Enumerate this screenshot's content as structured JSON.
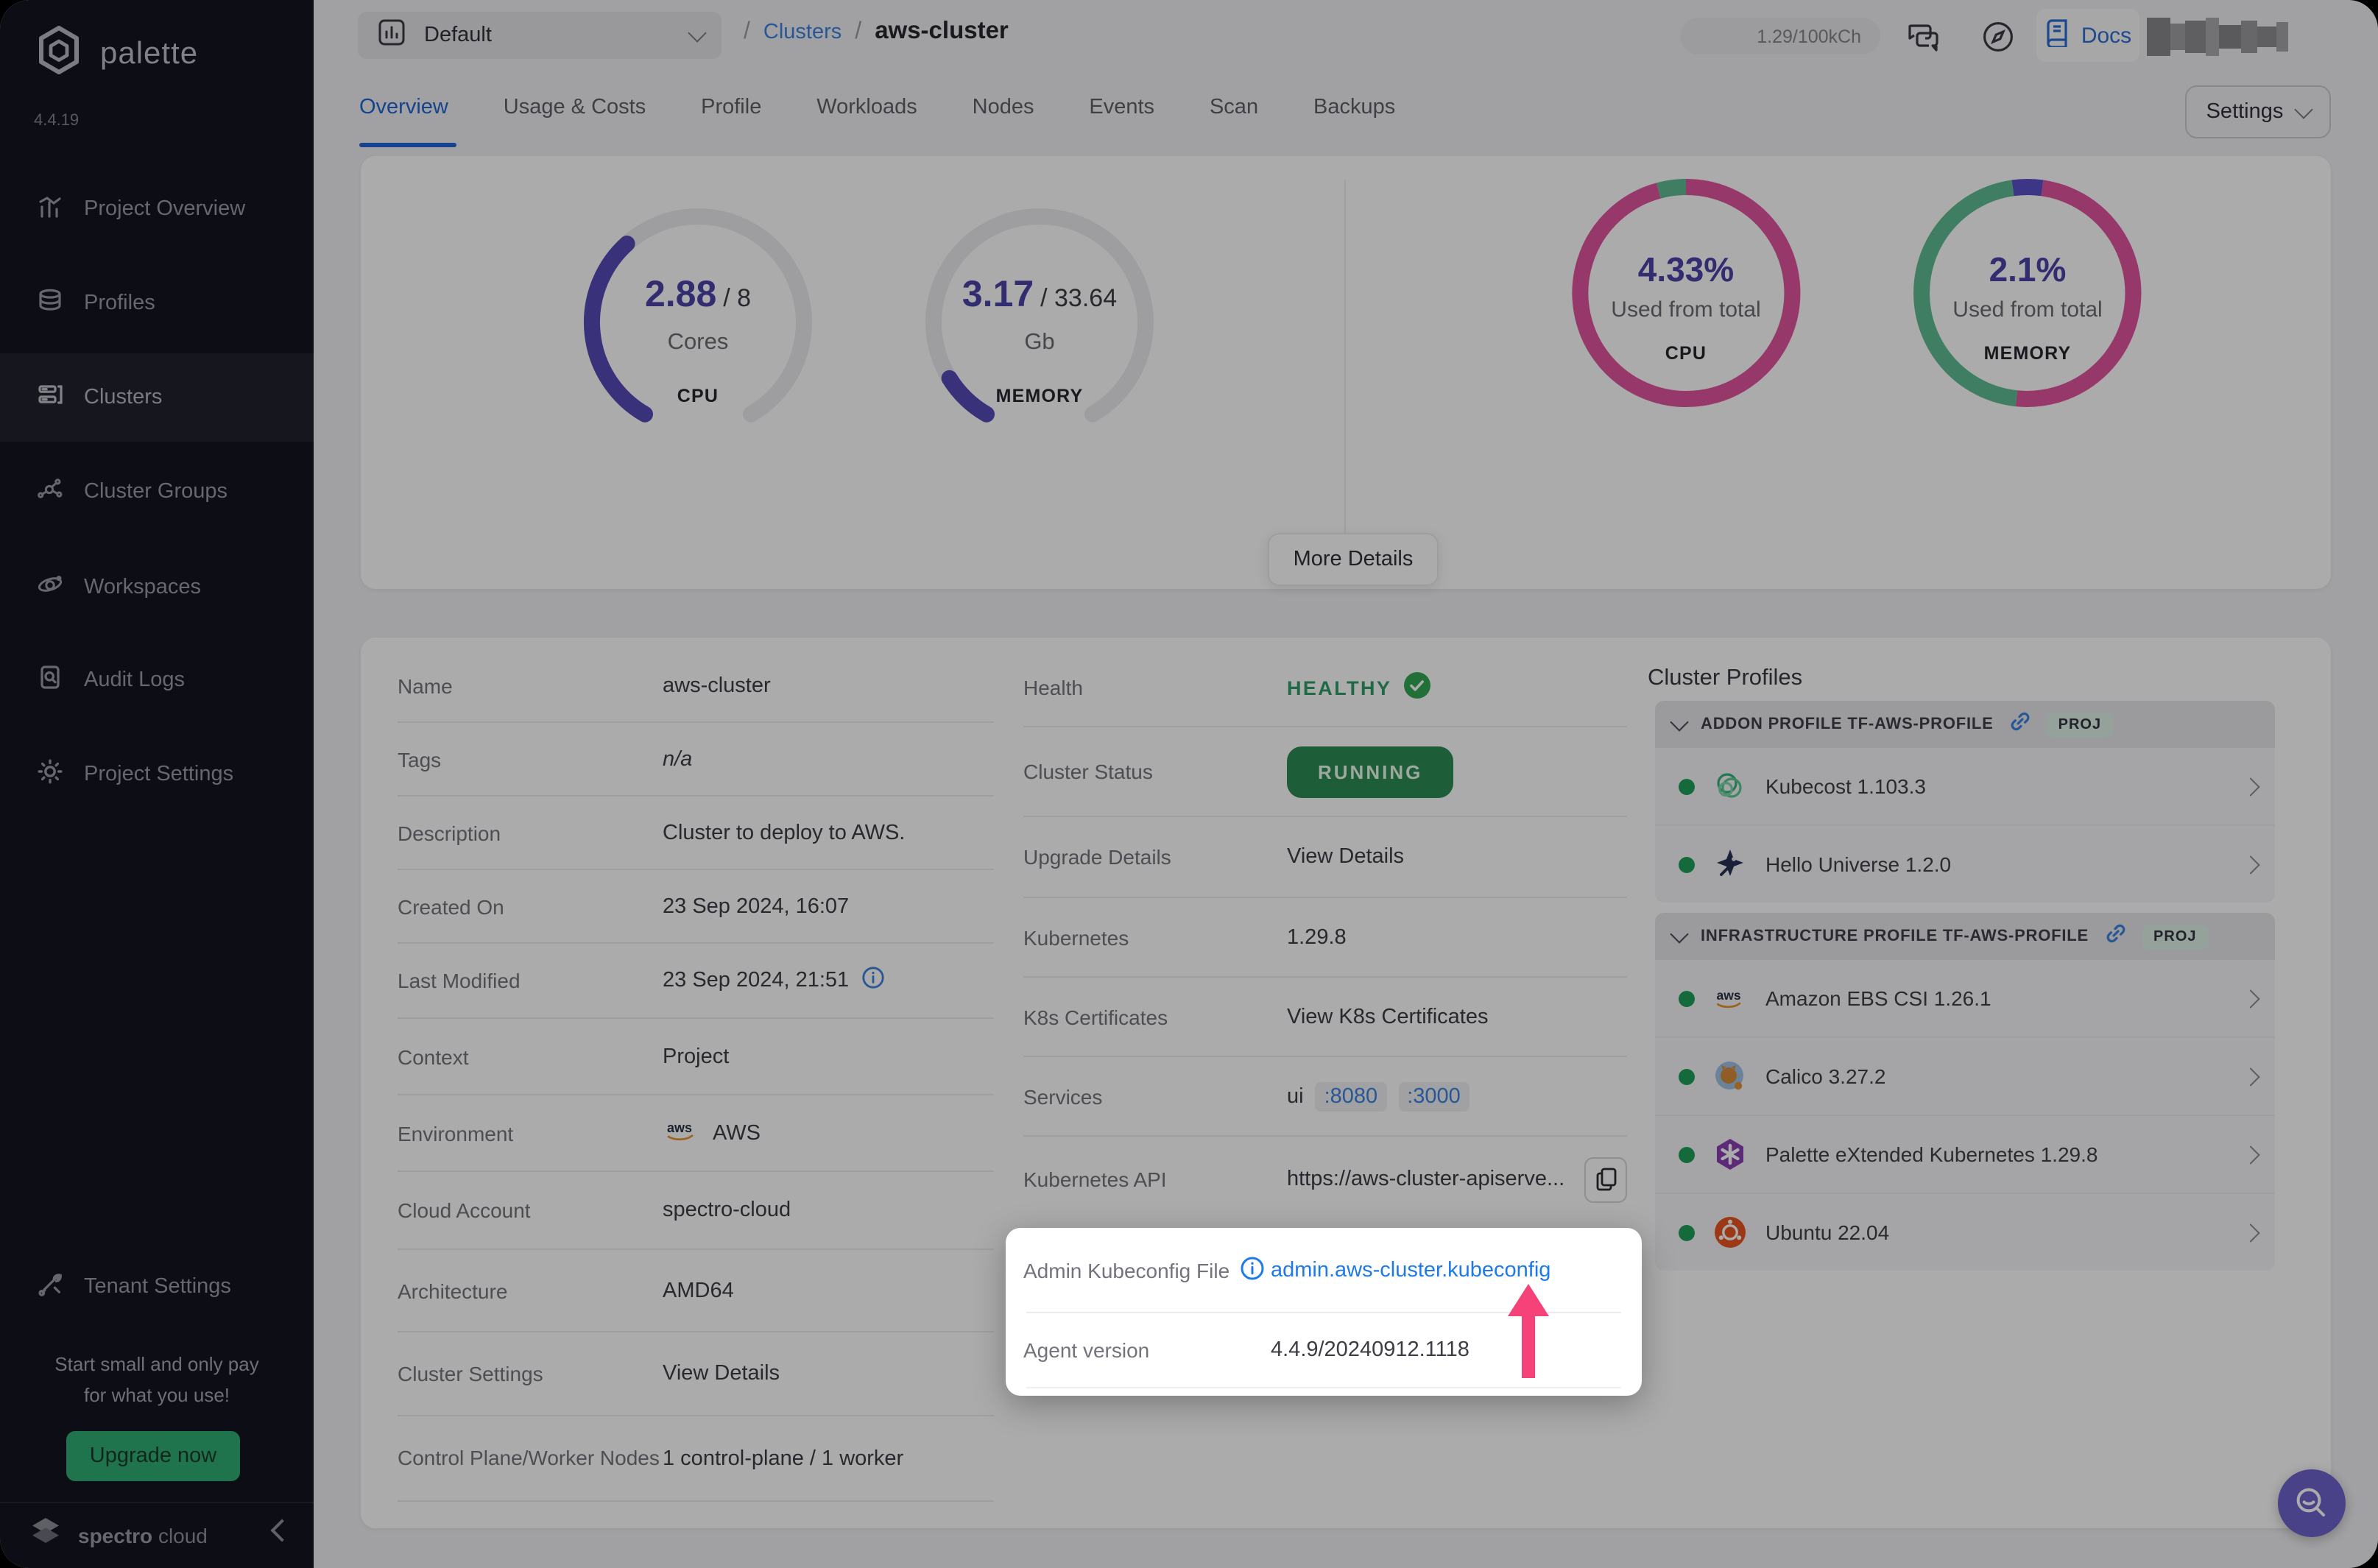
{
  "window": {
    "brand": "palette",
    "version": "4.4.19"
  },
  "sidebar": {
    "items": [
      {
        "label": "Project Overview"
      },
      {
        "label": "Profiles"
      },
      {
        "label": "Clusters"
      },
      {
        "label": "Cluster Groups"
      },
      {
        "label": "Workspaces"
      },
      {
        "label": "Audit Logs"
      },
      {
        "label": "Project Settings"
      }
    ],
    "tenant_settings": "Tenant Settings",
    "promo_line1": "Start small and only pay",
    "promo_line2": "for what you use!",
    "upgrade_button": "Upgrade now",
    "footer_brand_bold": "spectro",
    "footer_brand_light": "cloud"
  },
  "header": {
    "project_selector": "Default",
    "breadcrumb_sep1": "/",
    "breadcrumb_link": "Clusters",
    "breadcrumb_sep2": "/",
    "breadcrumb_current": "aws-cluster",
    "usage_pill": "1.29/100kCh",
    "docs_label": "Docs"
  },
  "tabs": {
    "items": [
      {
        "label": "Overview"
      },
      {
        "label": "Usage & Costs"
      },
      {
        "label": "Profile"
      },
      {
        "label": "Workloads"
      },
      {
        "label": "Nodes"
      },
      {
        "label": "Events"
      },
      {
        "label": "Scan"
      },
      {
        "label": "Backups"
      }
    ],
    "active": "Overview",
    "settings_button": "Settings"
  },
  "metrics": {
    "cpu_gauge": {
      "used": "2.88",
      "total": "/ 8",
      "unit": "Cores",
      "label": "CPU"
    },
    "memory_gauge": {
      "used": "3.17",
      "total": "/ 33.64",
      "unit": "Gb",
      "label": "MEMORY"
    },
    "cpu_donut": {
      "value": "4.33%",
      "caption": "Used from total",
      "label": "CPU"
    },
    "memory_donut": {
      "value": "2.1%",
      "caption": "Used from total",
      "label": "MEMORY"
    },
    "more_details_button": "More Details"
  },
  "chart_data": [
    {
      "type": "gauge",
      "title": "CPU",
      "value": 2.88,
      "max": 8,
      "unit": "Cores",
      "fill_color": "#564bb8",
      "track_color": "#ececf1"
    },
    {
      "type": "gauge",
      "title": "MEMORY",
      "value": 3.17,
      "max": 33.64,
      "unit": "Gb",
      "fill_color": "#564bb8",
      "track_color": "#ececf1"
    },
    {
      "type": "donut",
      "title": "CPU",
      "center_value": "4.33%",
      "caption": "Used from total",
      "segments": [
        {
          "name": "green",
          "pct": 4.2,
          "color": "#5fbd92"
        },
        {
          "name": "magenta",
          "pct": 95.8,
          "color": "#e0569e"
        }
      ]
    },
    {
      "type": "donut",
      "title": "MEMORY",
      "center_value": "2.1%",
      "caption": "Used from total",
      "segments": [
        {
          "name": "purple",
          "pct": 4.4,
          "color": "#5b51c8"
        },
        {
          "name": "magenta",
          "pct": 49.5,
          "color": "#e0569e"
        },
        {
          "name": "green",
          "pct": 46.1,
          "color": "#5fbd92"
        }
      ]
    }
  ],
  "details": {
    "rows": [
      {
        "label": "Name",
        "value": "aws-cluster"
      },
      {
        "label": "Tags",
        "value": "n/a"
      },
      {
        "label": "Description",
        "value": "Cluster to deploy to AWS."
      },
      {
        "label": "Created On",
        "value": "23 Sep 2024, 16:07"
      },
      {
        "label": "Last Modified",
        "value": "23 Sep 2024, 21:51"
      },
      {
        "label": "Context",
        "value": "Project"
      },
      {
        "label": "Environment",
        "value": "AWS"
      },
      {
        "label": "Cloud Account",
        "value": "spectro-cloud"
      },
      {
        "label": "Architecture",
        "value": "AMD64"
      },
      {
        "label": "Cluster Settings",
        "value": "View Details"
      },
      {
        "label": "Control Plane/Worker Nodes",
        "value": "1 control-plane / 1 worker"
      }
    ]
  },
  "status": {
    "health_label": "Health",
    "health_value": "HEALTHY",
    "cluster_status_label": "Cluster Status",
    "cluster_status_value": "RUNNING",
    "upgrade_label": "Upgrade Details",
    "upgrade_value": "View Details",
    "kubernetes_label": "Kubernetes",
    "kubernetes_value": "1.29.8",
    "certs_label": "K8s Certificates",
    "certs_value": "View K8s Certificates",
    "services_label": "Services",
    "services_name": "ui",
    "services_port1": ":8080",
    "services_port2": ":3000",
    "api_label": "Kubernetes API",
    "api_value": "https://aws-cluster-apiserve..."
  },
  "kubeconfig_box": {
    "admin_label": "Admin Kubeconfig File",
    "admin_value": "admin.aws-cluster.kubeconfig",
    "agent_label": "Agent version",
    "agent_value": "4.4.9/20240912.1118"
  },
  "profiles": {
    "title": "Cluster Profiles",
    "sections": [
      {
        "name": "ADDON PROFILE TF-AWS-PROFILE",
        "badge": "PROJ",
        "items": [
          {
            "name": "Kubecost 1.103.3"
          },
          {
            "name": "Hello Universe 1.2.0"
          }
        ]
      },
      {
        "name": "INFRASTRUCTURE PROFILE TF-AWS-PROFILE",
        "badge": "PROJ",
        "items": [
          {
            "name": "Amazon EBS CSI 1.26.1"
          },
          {
            "name": "Calico 3.27.2"
          },
          {
            "name": "Palette eXtended Kubernetes 1.29.8"
          },
          {
            "name": "Ubuntu 22.04"
          }
        ]
      }
    ]
  },
  "colors": {
    "accent_blue": "#3b82e0",
    "magenta": "#e0569e",
    "green": "#5fbd92",
    "indigo": "#564bb8",
    "running_green": "#2c8b52",
    "healthy_green": "#2f9e68",
    "highlight_pink": "#f5437a",
    "sidebar_bg": "#141420"
  }
}
